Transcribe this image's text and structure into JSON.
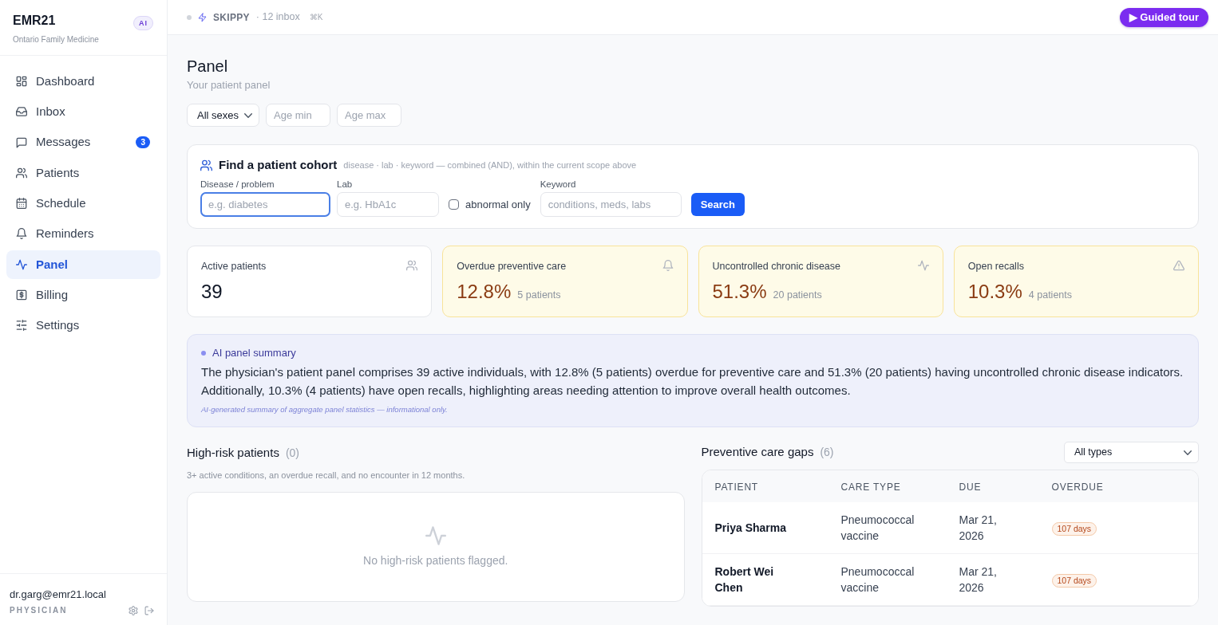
{
  "app": {
    "name": "EMR21",
    "subtitle": "Ontario Family Medicine",
    "badge": "AI"
  },
  "sidebar": {
    "items": [
      {
        "label": "Dashboard",
        "selected": false
      },
      {
        "label": "Inbox",
        "selected": false
      },
      {
        "label": "Messages",
        "selected": false,
        "badge": "3"
      },
      {
        "label": "Patients",
        "selected": false
      },
      {
        "label": "Schedule",
        "selected": false
      },
      {
        "label": "Reminders",
        "selected": false
      },
      {
        "label": "Panel",
        "selected": true
      },
      {
        "label": "Billing",
        "selected": false
      },
      {
        "label": "Settings",
        "selected": false
      }
    ]
  },
  "user": {
    "email": "dr.garg@emr21.local",
    "role": "PHYSICIAN"
  },
  "top_bar": {
    "assistant": "SKIPPY",
    "inbox": "· 12 inbox",
    "shortcut": "⌘K",
    "tour_button": "▶ Guided tour"
  },
  "page": {
    "title": "Panel",
    "subtitle": "Your patient panel"
  },
  "filters": {
    "sex": {
      "value": "All sexes"
    },
    "age_min": {
      "placeholder": "Age min"
    },
    "age_max": {
      "placeholder": "Age max"
    }
  },
  "cohort": {
    "title": "Find a patient cohort",
    "hint": "disease · lab · keyword — combined (AND), within the current scope above",
    "fields": [
      {
        "kind": "input",
        "label": "Disease / problem",
        "placeholder": "e.g. diabetes",
        "focused": true
      },
      {
        "kind": "input",
        "label": "Lab",
        "placeholder": "e.g. HbA1c",
        "focused": false
      },
      {
        "kind": "checkbox",
        "label": "abnormal only",
        "checked": false
      },
      {
        "kind": "input",
        "label": "Keyword",
        "placeholder": "conditions, meds, labs",
        "focused": false
      }
    ],
    "button": "Search"
  },
  "stats": [
    {
      "kind": "plain",
      "label": "Active patients",
      "value": "39"
    },
    {
      "kind": "warning",
      "label": "Overdue preventive care",
      "value": "12.8%",
      "detail": "5 patients"
    },
    {
      "kind": "warning",
      "label": "Uncontrolled chronic disease",
      "value": "51.3%",
      "detail": "20 patients"
    },
    {
      "kind": "warning",
      "label": "Open recalls",
      "value": "10.3%",
      "detail": "4 patients"
    }
  ],
  "ai_summary": {
    "title": "AI panel summary",
    "text": "The physician's patient panel comprises 39 active individuals, with 12.8% (5 patients) overdue for preventive care and 51.3% (20 patients) having uncontrolled chronic disease indicators. Additionally, 10.3% (4 patients) have open recalls, highlighting areas needing attention to improve overall health outcomes.",
    "footnote": "AI-generated summary of aggregate panel statistics — informational only."
  },
  "high_risk": {
    "title": "High-risk patients",
    "count": "(0)",
    "subtitle": "3+ active conditions, an overdue recall, and no encounter in 12 months.",
    "empty_text": "No high-risk patients flagged."
  },
  "care_gaps": {
    "title": "Preventive care gaps",
    "count": "(6)",
    "filter": {
      "value": "All types"
    },
    "table": {
      "columns": [
        "PATIENT",
        "CARE TYPE",
        "DUE",
        "OVERDUE"
      ],
      "rows": [
        {
          "patient": "Priya Sharma",
          "care_type": "Pneumococcal vaccine",
          "due": "Mar 21, 2026",
          "overdue": "107 days"
        },
        {
          "patient": "Robert Wei Chen",
          "care_type": "Pneumococcal vaccine",
          "due": "Mar 21, 2026",
          "overdue": "107 days"
        }
      ]
    }
  }
}
